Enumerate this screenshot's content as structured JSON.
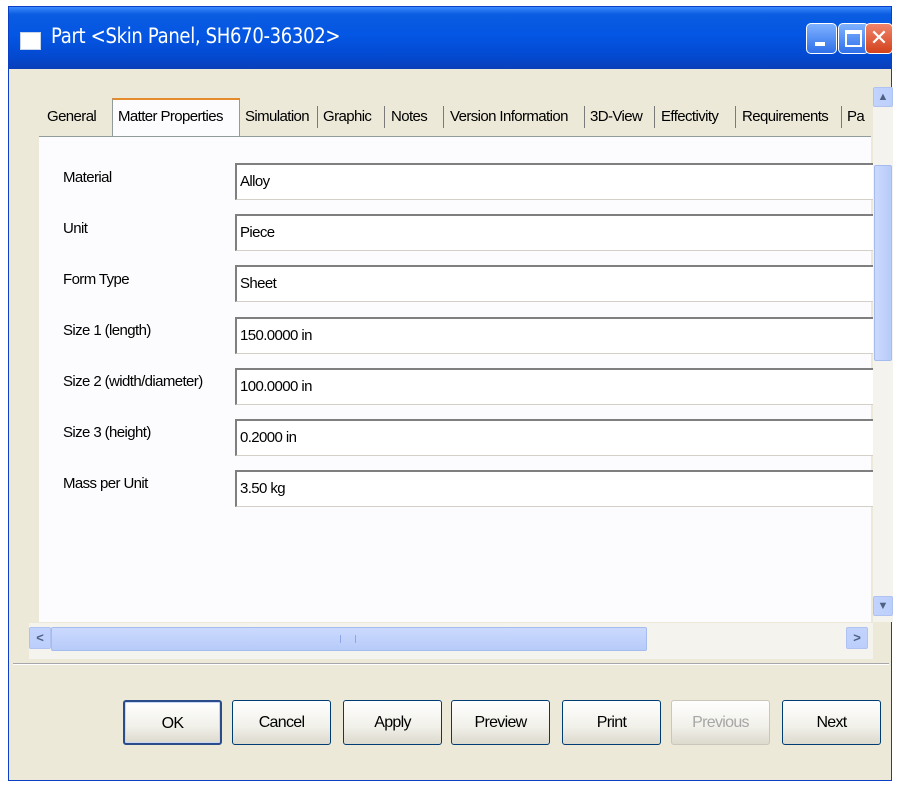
{
  "window": {
    "title": "Part <Skin Panel, SH670-36302>",
    "close_glyph": "✕"
  },
  "tabs": [
    {
      "label": "General",
      "selected": false
    },
    {
      "label": "Matter Properties",
      "selected": true
    },
    {
      "label": "Simulation",
      "selected": false
    },
    {
      "label": "Graphic",
      "selected": false
    },
    {
      "label": "Notes",
      "selected": false
    },
    {
      "label": "Version Information",
      "selected": false
    },
    {
      "label": "3D-View",
      "selected": false
    },
    {
      "label": "Effectivity",
      "selected": false
    },
    {
      "label": "Requirements",
      "selected": false
    },
    {
      "label": "Pa",
      "selected": false
    }
  ],
  "properties": [
    {
      "label": "Material",
      "value": "Alloy"
    },
    {
      "label": "Unit",
      "value": "Piece"
    },
    {
      "label": "Form Type",
      "value": "Sheet"
    },
    {
      "label": "Size 1 (length)",
      "value": "150.0000 in"
    },
    {
      "label": "Size 2 (width/diameter)",
      "value": "100.0000 in"
    },
    {
      "label": "Size 3 (height)",
      "value": "0.2000 in"
    },
    {
      "label": "Mass per Unit",
      "value": "3.50 kg"
    }
  ],
  "scroll": {
    "up_glyph": "▲",
    "down_glyph": "▼",
    "left_glyph": "<",
    "right_glyph": ">"
  },
  "buttons": {
    "ok": "OK",
    "cancel": "Cancel",
    "apply": "Apply",
    "preview": "Preview",
    "print": "Print",
    "previous": "Previous",
    "next": "Next"
  },
  "colors": {
    "title_bar": "#0456e4",
    "dialog_face": "#ece9d8",
    "tab_highlight": "#e68b2c"
  }
}
